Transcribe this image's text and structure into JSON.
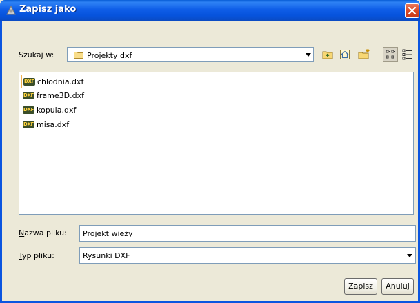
{
  "window": {
    "title": "Zapisz jako"
  },
  "lookin": {
    "label": "Szukaj w:",
    "folder": "Projekty dxf"
  },
  "toolbar": {
    "up_folder_icon": "up-folder-icon",
    "home_icon": "home-icon",
    "new_folder_icon": "new-folder-icon",
    "list_view_icon": "list-view-icon",
    "details_view_icon": "details-view-icon"
  },
  "files": [
    {
      "icon_text": "DXF",
      "name": "chlodnia.dxf"
    },
    {
      "icon_text": "DXF",
      "name": "frame3D.dxf"
    },
    {
      "icon_text": "DXF",
      "name": "kopula.dxf"
    },
    {
      "icon_text": "DXF",
      "name": "misa.dxf"
    }
  ],
  "filename": {
    "label_first": "N",
    "label_rest": "azwa pliku:",
    "value": "Projekt wieży"
  },
  "filetype": {
    "label_first": "T",
    "label_rest": "yp pliku:",
    "value": "Rysunki DXF"
  },
  "buttons": {
    "save": "Zapisz",
    "cancel": "Anuluj"
  },
  "colors": {
    "titlebar": "#0f5ee8",
    "close": "#dc4b26",
    "selection_border": "#f0b050"
  }
}
